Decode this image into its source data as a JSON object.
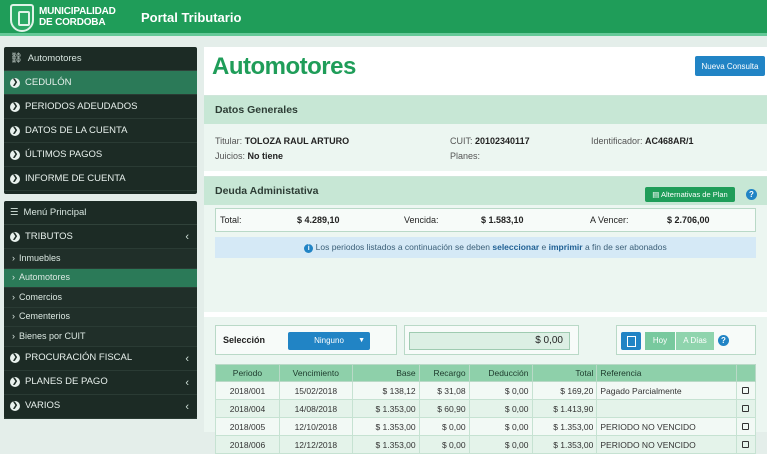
{
  "header": {
    "brand_line1": "MUNICIPALIDAD",
    "brand_line2": "DE CORDOBA",
    "portal_title": "Portal Tributario"
  },
  "sidebar_top": {
    "title": "Automotores",
    "items": [
      {
        "label": "CEDULÓN"
      },
      {
        "label": "PERIODOS ADEUDADOS"
      },
      {
        "label": "DATOS DE LA CUENTA"
      },
      {
        "label": "ÚLTIMOS PAGOS"
      },
      {
        "label": "INFORME DE CUENTA"
      }
    ]
  },
  "sidebar_main": {
    "title": "Menú Principal",
    "tributos": "TRIBUTOS",
    "subitems": [
      {
        "label": "Inmuebles"
      },
      {
        "label": "Automotores"
      },
      {
        "label": "Comercios"
      },
      {
        "label": "Cementerios"
      },
      {
        "label": "Bienes por CUIT"
      }
    ],
    "items": [
      {
        "label": "PROCURACIÓN FISCAL"
      },
      {
        "label": "PLANES DE PAGO"
      },
      {
        "label": "VARIOS"
      }
    ]
  },
  "main": {
    "title": "Automotores",
    "new_query": "Nueva Consulta"
  },
  "datos_generales": {
    "title": "Datos Generales",
    "titular_label": "Titular:",
    "titular": "TOLOZA RAUL ARTURO",
    "cuit_label": "CUIT:",
    "cuit": "20102340117",
    "ident_label": "Identificador:",
    "ident": "AC468AR/1",
    "juicios_label": "Juicios:",
    "juicios": "No tiene",
    "planes_label": "Planes:"
  },
  "deuda": {
    "title": "Deuda Administativa",
    "alt_button": "Alternativas de Plan",
    "total_label": "Total:",
    "total": "$ 4.289,10",
    "vencida_label": "Vencida:",
    "vencida": "$ 1.583,10",
    "avencer_label": "A Vencer:",
    "avencer": "$ 2.706,00",
    "info_pre": "Los periodos listados a continuación se deben ",
    "info_sel": "seleccionar",
    "info_mid": " e ",
    "info_imp": "imprimir",
    "info_post": " a fin de ser abonados"
  },
  "seleccion": {
    "label": "Selección",
    "dropdown": "Ninguno",
    "amount": "$ 0,00",
    "hoy": "Hoy",
    "adias": "A Días"
  },
  "table": {
    "headers": [
      "Periodo",
      "Vencimiento",
      "Base",
      "Recargo",
      "Deducción",
      "Total",
      "Referencia"
    ],
    "rows": [
      [
        "2018/001",
        "15/02/2018",
        "$ 138,12",
        "$ 31,08",
        "$ 0,00",
        "$ 169,20",
        "Pagado Parcialmente"
      ],
      [
        "2018/004",
        "14/08/2018",
        "$ 1.353,00",
        "$ 60,90",
        "$ 0,00",
        "$ 1.413,90",
        ""
      ],
      [
        "2018/005",
        "12/10/2018",
        "$ 1.353,00",
        "$ 0,00",
        "$ 0,00",
        "$ 1.353,00",
        "PERIODO NO VENCIDO"
      ],
      [
        "2018/006",
        "12/12/2018",
        "$ 1.353,00",
        "$ 0,00",
        "$ 0,00",
        "$ 1.353,00",
        "PERIODO NO VENCIDO"
      ]
    ]
  },
  "colors": {
    "header_green": "#1f9d59",
    "sidebar_dark": "#1c2b25",
    "accent_blue": "#2184c5"
  }
}
